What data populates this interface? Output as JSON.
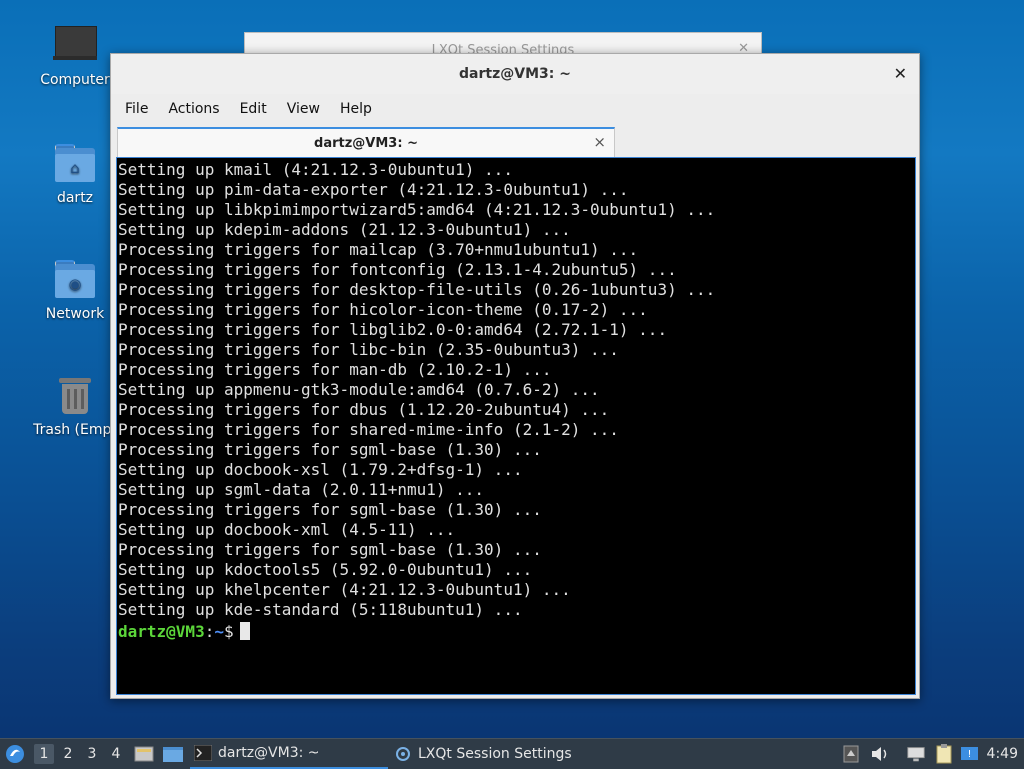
{
  "desktop": {
    "icons": [
      {
        "label": "Computer",
        "icon": "computer-icon"
      },
      {
        "label": "dartz",
        "icon": "home-folder-icon"
      },
      {
        "label": "Network",
        "icon": "network-folder-icon"
      },
      {
        "label": "Trash (Empt",
        "icon": "trash-icon"
      }
    ]
  },
  "background_window": {
    "title": "LXQt Session Settings"
  },
  "terminal": {
    "title": "dartz@VM3: ~",
    "menu": [
      "File",
      "Actions",
      "Edit",
      "View",
      "Help"
    ],
    "tab_label": "dartz@VM3: ~",
    "lines": [
      "Setting up kmail (4:21.12.3-0ubuntu1) ...",
      "Setting up pim-data-exporter (4:21.12.3-0ubuntu1) ...",
      "Setting up libkpimimportwizard5:amd64 (4:21.12.3-0ubuntu1) ...",
      "Setting up kdepim-addons (21.12.3-0ubuntu1) ...",
      "Processing triggers for mailcap (3.70+nmu1ubuntu1) ...",
      "Processing triggers for fontconfig (2.13.1-4.2ubuntu5) ...",
      "Processing triggers for desktop-file-utils (0.26-1ubuntu3) ...",
      "Processing triggers for hicolor-icon-theme (0.17-2) ...",
      "Processing triggers for libglib2.0-0:amd64 (2.72.1-1) ...",
      "Processing triggers for libc-bin (2.35-0ubuntu3) ...",
      "Processing triggers for man-db (2.10.2-1) ...",
      "Setting up appmenu-gtk3-module:amd64 (0.7.6-2) ...",
      "Processing triggers for dbus (1.12.20-2ubuntu4) ...",
      "Processing triggers for shared-mime-info (2.1-2) ...",
      "Processing triggers for sgml-base (1.30) ...",
      "Setting up docbook-xsl (1.79.2+dfsg-1) ...",
      "Setting up sgml-data (2.0.11+nmu1) ...",
      "Processing triggers for sgml-base (1.30) ...",
      "Setting up docbook-xml (4.5-11) ...",
      "Processing triggers for sgml-base (1.30) ...",
      "Setting up kdoctools5 (5.92.0-0ubuntu1) ...",
      "Setting up khelpcenter (4:21.12.3-0ubuntu1) ...",
      "Setting up kde-standard (5:118ubuntu1) ..."
    ],
    "prompt": {
      "user": "dartz@VM3",
      "sep": ":",
      "path": "~",
      "symbol": "$"
    }
  },
  "taskbar": {
    "workspaces": [
      "1",
      "2",
      "3",
      "4"
    ],
    "active_workspace": "1",
    "tasks": [
      {
        "label": "dartz@VM3: ~",
        "icon": "terminal-icon",
        "active": true
      },
      {
        "label": "LXQt Session Settings",
        "icon": "settings-icon",
        "active": false
      }
    ],
    "clock": "4:49"
  },
  "colors": {
    "accent": "#3c8ee0",
    "prompt_user": "#5cd63a",
    "prompt_path": "#4f8ff7"
  }
}
